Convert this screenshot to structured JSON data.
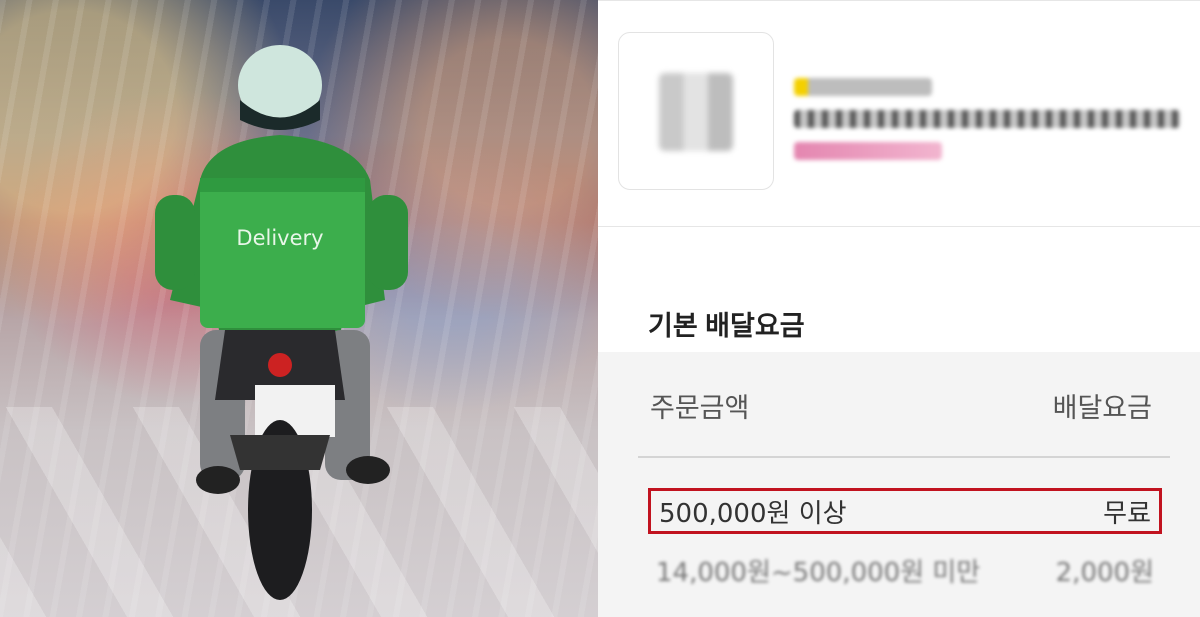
{
  "photo": {
    "bag_text": "Delivery",
    "colors": {
      "bag": "#3cae4c",
      "jacket": "#2f8f3c",
      "helmet": "#cfe6dd"
    }
  },
  "store": {
    "name_blurred": "",
    "phone_blurred": "",
    "promo_blurred": ""
  },
  "fee_section": {
    "title": "기본 배달요금",
    "header": {
      "order_amount": "주문금액",
      "delivery_fee": "배달요금"
    },
    "rows": [
      {
        "amount": "500,000원 이상",
        "fee": "무료",
        "highlighted": true
      },
      {
        "amount": "14,000원~500,000원 미만",
        "fee": "2,000원",
        "highlighted": false
      }
    ],
    "highlight_color": "#c1121f"
  }
}
